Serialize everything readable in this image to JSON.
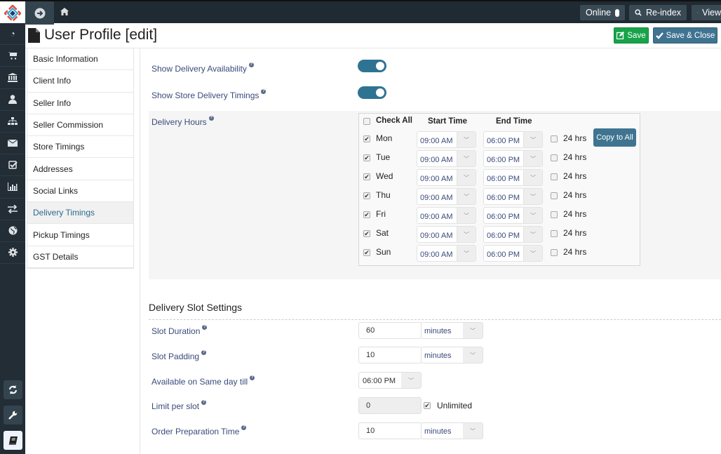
{
  "topbar": {
    "online_label": "Online",
    "reindex_label": "Re-index",
    "view_label": "View"
  },
  "sidebar_icons": [
    "dashboard-icon",
    "cart-icon",
    "bank-icon",
    "user-icon",
    "sitemap-icon",
    "envelope-icon",
    "check-square-icon",
    "bar-chart-icon",
    "exchange-icon",
    "globe-icon",
    "gear-icon"
  ],
  "page": {
    "title": "User Profile [edit]",
    "save_label": "Save",
    "save_close_label": "Save & Close"
  },
  "tabs": [
    {
      "label": "Basic Information",
      "active": false
    },
    {
      "label": "Client Info",
      "active": false
    },
    {
      "label": "Seller Info",
      "active": false
    },
    {
      "label": "Seller Commission",
      "active": false
    },
    {
      "label": "Store Timings",
      "active": false
    },
    {
      "label": "Addresses",
      "active": false
    },
    {
      "label": "Social Links",
      "active": false
    },
    {
      "label": "Delivery Timings",
      "active": true
    },
    {
      "label": "Pickup Timings",
      "active": false
    },
    {
      "label": "GST Details",
      "active": false
    }
  ],
  "form": {
    "show_delivery_availability": {
      "label": "Show Delivery Availability",
      "on": true
    },
    "show_store_delivery_timings": {
      "label": "Show Store Delivery Timings",
      "on": true
    },
    "delivery_hours": {
      "label": "Delivery Hours",
      "check_all_label": "Check All",
      "start_time_header": "Start Time",
      "end_time_header": "End Time",
      "copy_label": "Copy to All",
      "h24_label": "24 hrs",
      "days": [
        {
          "day": "Mon",
          "checked": true,
          "start": "09:00 AM",
          "end": "06:00 PM",
          "h24": false
        },
        {
          "day": "Tue",
          "checked": true,
          "start": "09:00 AM",
          "end": "06:00 PM",
          "h24": false
        },
        {
          "day": "Wed",
          "checked": true,
          "start": "09:00 AM",
          "end": "06:00 PM",
          "h24": false
        },
        {
          "day": "Thu",
          "checked": true,
          "start": "09:00 AM",
          "end": "06:00 PM",
          "h24": false
        },
        {
          "day": "Fri",
          "checked": true,
          "start": "09:00 AM",
          "end": "06:00 PM",
          "h24": false
        },
        {
          "day": "Sat",
          "checked": true,
          "start": "09:00 AM",
          "end": "06:00 PM",
          "h24": false
        },
        {
          "day": "Sun",
          "checked": true,
          "start": "09:00 AM",
          "end": "06:00 PM",
          "h24": false
        }
      ]
    }
  },
  "slot_settings": {
    "title": "Delivery Slot Settings",
    "slot_duration": {
      "label": "Slot Duration",
      "value": "60",
      "unit": "minutes"
    },
    "slot_padding": {
      "label": "Slot Padding",
      "value": "10",
      "unit": "minutes"
    },
    "same_day_till": {
      "label": "Available on Same day till",
      "value": "06:00 PM"
    },
    "limit_per_slot": {
      "label": "Limit per slot",
      "value": "0",
      "unlimited_label": "Unlimited",
      "unlimited": true
    },
    "order_prep_time": {
      "label": "Order Preparation Time",
      "value": "10",
      "unit": "minutes"
    }
  }
}
